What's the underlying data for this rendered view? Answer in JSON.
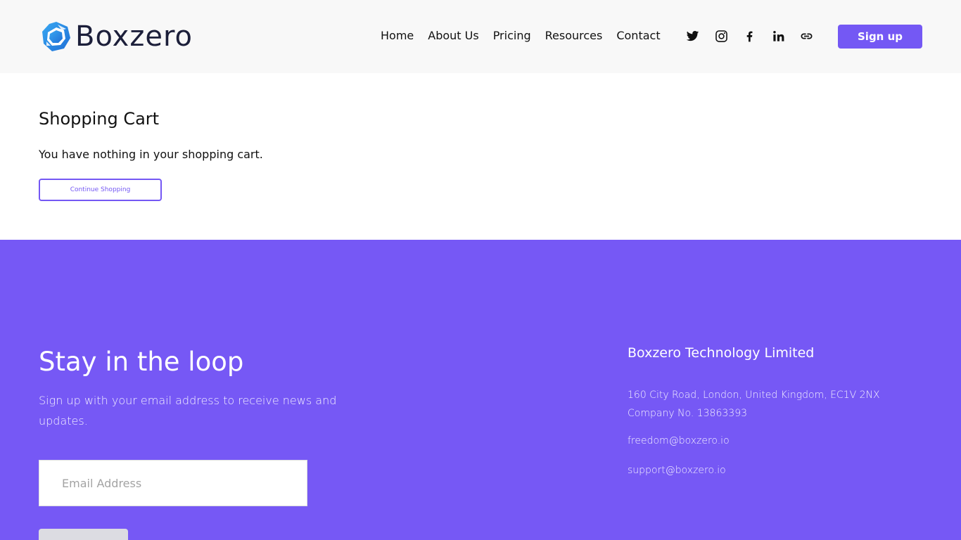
{
  "header": {
    "logo_text": "Boxzero",
    "nav": [
      "Home",
      "About Us",
      "Pricing",
      "Resources",
      "Contact"
    ],
    "socials": [
      "twitter-icon",
      "instagram-icon",
      "facebook-icon",
      "linkedin-icon",
      "link-icon"
    ],
    "signup_label": "Sign up"
  },
  "cart": {
    "title": "Shopping Cart",
    "empty_message": "You have nothing in your shopping cart.",
    "continue_label": "Continue Shopping"
  },
  "footer": {
    "newsletter_title": "Stay in the loop",
    "newsletter_desc": "Sign up with your email address to receive news and updates.",
    "email_placeholder": "Email Address",
    "company_name": "Boxzero Technology Limited",
    "address_line": "160 City Road, London, United Kingdom, EC1V 2NX",
    "company_no": "Company No. 13863393",
    "email_1": "freedom@boxzero.io",
    "email_2": "support@boxzero.io"
  },
  "colors": {
    "accent": "#7458f4",
    "footer_bg": "#7658f5",
    "header_bg": "#f8f8f8",
    "logo_blue": "#2b8fe8"
  }
}
